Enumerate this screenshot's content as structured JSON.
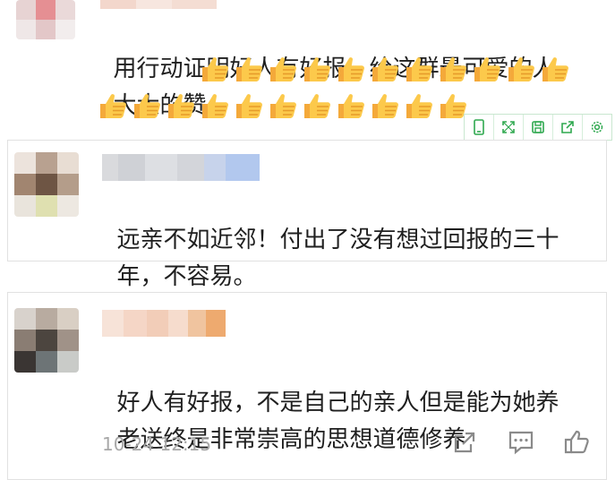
{
  "comments": [
    {
      "text": "用行动证明好人有好报，给这群最可爱的人大大的赞",
      "line1": "用行动证明好人有好报，给这群最可爱的人",
      "line2_prefix": "大大的赞",
      "emoji": "thumbs-up",
      "emoji_count_line2": 11,
      "emoji_count_line3": 11
    },
    {
      "line1": "远亲不如近邻！付出了没有想过回报的三十",
      "line2": "年，不容易。"
    },
    {
      "line1": "好人有好报，不是自己的亲人但是能为她养",
      "line2": "老送终是非常崇高的思想道德修养",
      "timestamp": "10-24 12:15"
    }
  ],
  "toolbar": {
    "tools": [
      "phone-icon",
      "expand-icon",
      "save-icon",
      "share-icon",
      "gear-icon"
    ],
    "accent": "#2fa84f"
  },
  "actions": [
    "share-icon",
    "comment-icon",
    "like-icon"
  ],
  "colors": {
    "text": "#1f1f1f",
    "meta": "#a8a8a8",
    "border": "#e1e1e1"
  }
}
